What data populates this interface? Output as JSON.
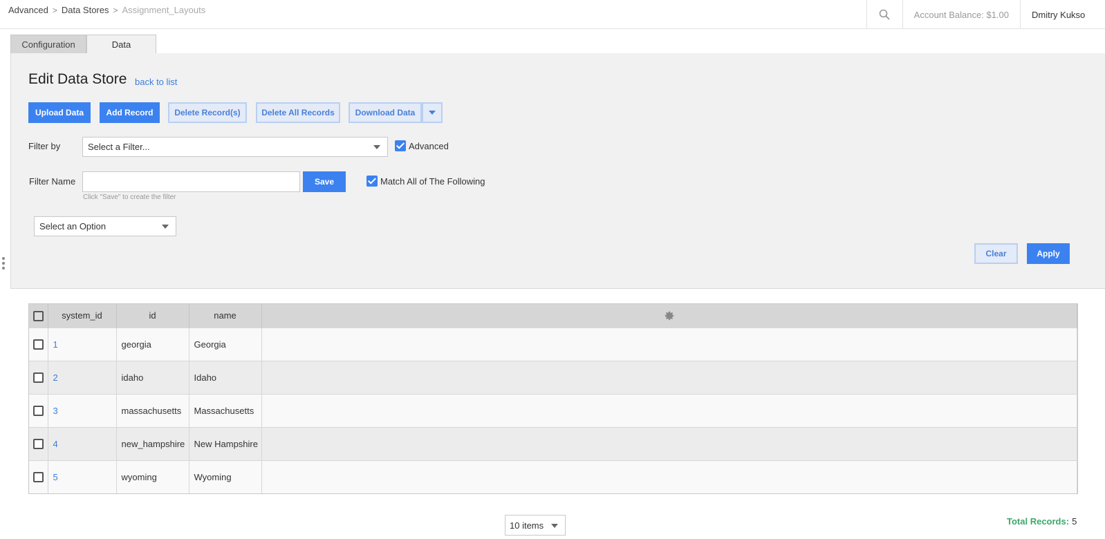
{
  "breadcrumb": {
    "items": [
      "Advanced",
      "Data Stores",
      "Assignment_Layouts"
    ],
    "separator": ">"
  },
  "header": {
    "account_balance": "Account Balance: $1.00",
    "user_name": "Dmitry Kukso"
  },
  "tabs": [
    {
      "label": "Configuration",
      "active": false
    },
    {
      "label": "Data",
      "active": true
    }
  ],
  "page": {
    "title": "Edit Data Store",
    "back_link": "back to list"
  },
  "toolbar": {
    "upload": "Upload Data",
    "add": "Add Record",
    "delete": "Delete Record(s)",
    "delete_all": "Delete All Records",
    "download": "Download Data"
  },
  "filter": {
    "filter_by_label": "Filter by",
    "filter_select_value": "Select a Filter...",
    "advanced_label": "Advanced",
    "advanced_checked": true,
    "filter_name_label": "Filter Name",
    "filter_name_value": "",
    "save_label": "Save",
    "hint": "Click \"Save\" to create the filter",
    "match_all_label": "Match All of The Following",
    "match_all_checked": true,
    "option_select_value": "Select an Option",
    "clear_label": "Clear",
    "apply_label": "Apply"
  },
  "table": {
    "columns": [
      "system_id",
      "id",
      "name"
    ],
    "rows": [
      {
        "system_id": "1",
        "id": "georgia",
        "name": "Georgia"
      },
      {
        "system_id": "2",
        "id": "idaho",
        "name": "Idaho"
      },
      {
        "system_id": "3",
        "id": "massachusetts",
        "name": "Massachusetts"
      },
      {
        "system_id": "4",
        "id": "new_hampshire",
        "name": "New Hampshire"
      },
      {
        "system_id": "5",
        "id": "wyoming",
        "name": "Wyoming"
      }
    ]
  },
  "footer": {
    "page_size": "10 items",
    "total_label": "Total Records:",
    "total_value": "5"
  },
  "colors": {
    "primary": "#3b82f0",
    "link": "#3b7ddd",
    "total_label": "#3aa86b"
  },
  "icons": [
    "search-icon",
    "chevron-right-icon",
    "caret-down-icon",
    "gear-icon",
    "checkbox-icon",
    "drag-handle-icon"
  ]
}
